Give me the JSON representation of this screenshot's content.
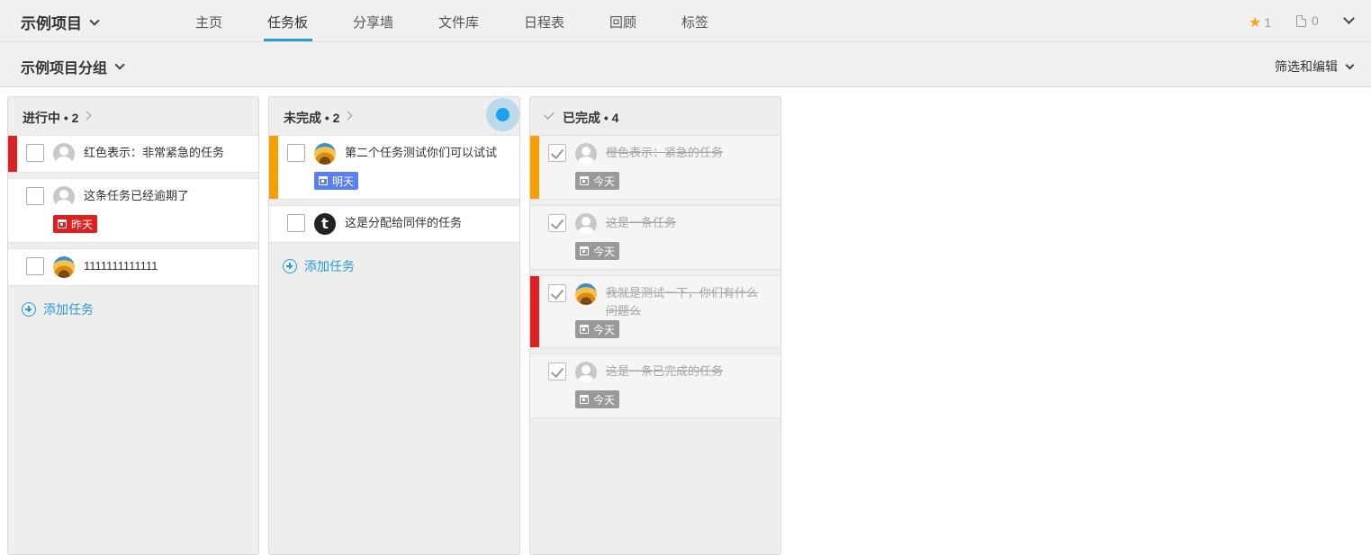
{
  "header": {
    "project_title": "示例项目",
    "tabs": [
      {
        "label": "主页"
      },
      {
        "label": "任务板"
      },
      {
        "label": "分享墙"
      },
      {
        "label": "文件库"
      },
      {
        "label": "日程表"
      },
      {
        "label": "回顾"
      },
      {
        "label": "标签"
      }
    ],
    "active_tab": "任务板",
    "star_count": "1",
    "file_count": "0"
  },
  "subheader": {
    "group_title": "示例项目分组",
    "filter_label": "筛选和编辑"
  },
  "columns": [
    {
      "title": "进行中 • 2",
      "cards": [
        {
          "title": "红色表示：非常紧急的任务",
          "avatar": "default-avatar",
          "priority_color": "#e02020",
          "done": false
        },
        {
          "title": "这条任务已经逾期了",
          "avatar": "default-avatar",
          "due": "昨天",
          "due_color": "#e02020",
          "done": false
        },
        {
          "title": "1111111111111",
          "avatar": "sunflower-avatar",
          "done": false
        }
      ],
      "add_label": "添加任务"
    },
    {
      "title": "未完成 • 2",
      "cards": [
        {
          "title": "第二个任务测试你们可以试试",
          "avatar": "sunflower-avatar",
          "priority_color": "#f5a000",
          "due": "明天",
          "due_color": "#5a7ff0",
          "done": false
        },
        {
          "title": "这是分配给同伴的任务",
          "avatar": "t-avatar",
          "avatar_letter": "t",
          "done": false
        }
      ],
      "add_label": "添加任务"
    },
    {
      "title": "已完成 • 4",
      "cards": [
        {
          "title": "橙色表示：紧急的任务",
          "avatar": "default-avatar",
          "priority_color": "#f5a000",
          "due": "今天",
          "due_color": "#999999",
          "done": true
        },
        {
          "title": "这是一条任务",
          "avatar": "default-avatar",
          "due": "今天",
          "due_color": "#999999",
          "done": true
        },
        {
          "title": "我就是测试一下，你们有什么问题么",
          "avatar": "sunflower-avatar",
          "priority_color": "#e02020",
          "due": "今天",
          "due_color": "#999999",
          "done": true
        },
        {
          "title": "这是一条已完成的任务",
          "avatar": "default-avatar",
          "due": "今天",
          "due_color": "#999999",
          "done": true
        }
      ]
    }
  ]
}
